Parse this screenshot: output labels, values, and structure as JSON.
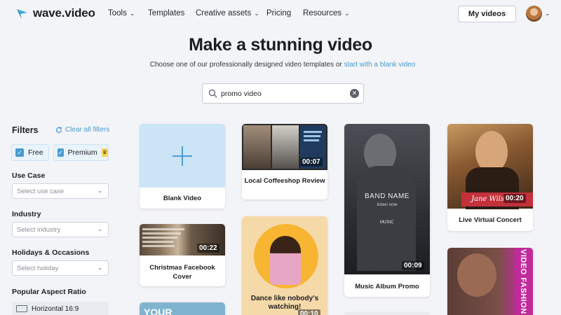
{
  "header": {
    "logo_text": "wave.video",
    "nav": {
      "tools": "Tools",
      "templates": "Templates",
      "creative": "Creative assets",
      "pricing": "Pricing",
      "resources": "Resources"
    },
    "my_videos": "My videos"
  },
  "hero": {
    "title": "Make a stunning video",
    "subtitle": "Choose one of our professionally designed video templates or ",
    "subtitle_link": "start with a blank video"
  },
  "search": {
    "value": "promo video",
    "placeholder": ""
  },
  "filters": {
    "title": "Filters",
    "clear_all": "Clear all filters",
    "chips": {
      "free": "Free",
      "premium": "Premium"
    },
    "use_case": {
      "label": "Use Case",
      "placeholder": "Select use case"
    },
    "industry": {
      "label": "Industry",
      "placeholder": "Select industry"
    },
    "holidays": {
      "label": "Holidays & Occasions",
      "placeholder": "Select holiday"
    },
    "aspect": {
      "label": "Popular Aspect Ratio",
      "option": "Horizontal 16:9"
    }
  },
  "cards": {
    "blank": {
      "label": "Blank Video"
    },
    "coffeeshop": {
      "label": "Local Coffeeshop Review",
      "duration": "00:07"
    },
    "christmas": {
      "label": "Christmas Facebook Cover",
      "duration": "00:22",
      "overlay": "YOUR"
    },
    "dance": {
      "label": "Dance like nobody's watching!",
      "duration": "00:10"
    },
    "music": {
      "label": "Music Album Promo",
      "duration": "00:09",
      "band": "BAND NAME",
      "listen": "listen now",
      "service": "MUSIC"
    },
    "concert": {
      "label": "Live Virtual Concert",
      "duration": "00:20",
      "name": "Jane Wils"
    },
    "fashion": {
      "text": "VIDEO FASHION"
    },
    "partial": {
      "text": "YOUR"
    }
  },
  "colors": {
    "accent": "#4a9bd0",
    "chip_bg": "#e9f3fb",
    "blank_bg": "#cbe5f7"
  }
}
